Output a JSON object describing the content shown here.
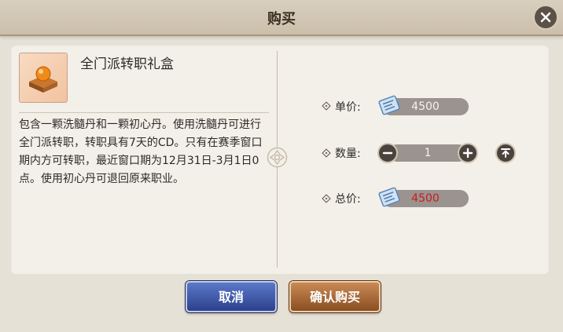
{
  "dialog": {
    "title": "购买",
    "close_icon": "close-icon"
  },
  "item": {
    "name": "全门派转职礼盒",
    "icon": "gift-box-orb-icon",
    "description": "包含一颗洗髓丹和一颗初心丹。使用洗髓丹可进行全门派转职，转职具有7天的CD。只有在赛季窗口期内方可转职，最近窗口期为12月31日-3月1日0点。使用初心丹可退回原来职业。"
  },
  "purchase": {
    "unit_price_label": "单价:",
    "unit_price_value": "4500",
    "quantity_label": "数量:",
    "quantity_value": "1",
    "total_label": "总价:",
    "total_value": "4500",
    "currency_icon": "ticket-currency-icon",
    "total_color": "#c91c1c"
  },
  "buttons": {
    "cancel_label": "取消",
    "confirm_label": "确认购买"
  }
}
